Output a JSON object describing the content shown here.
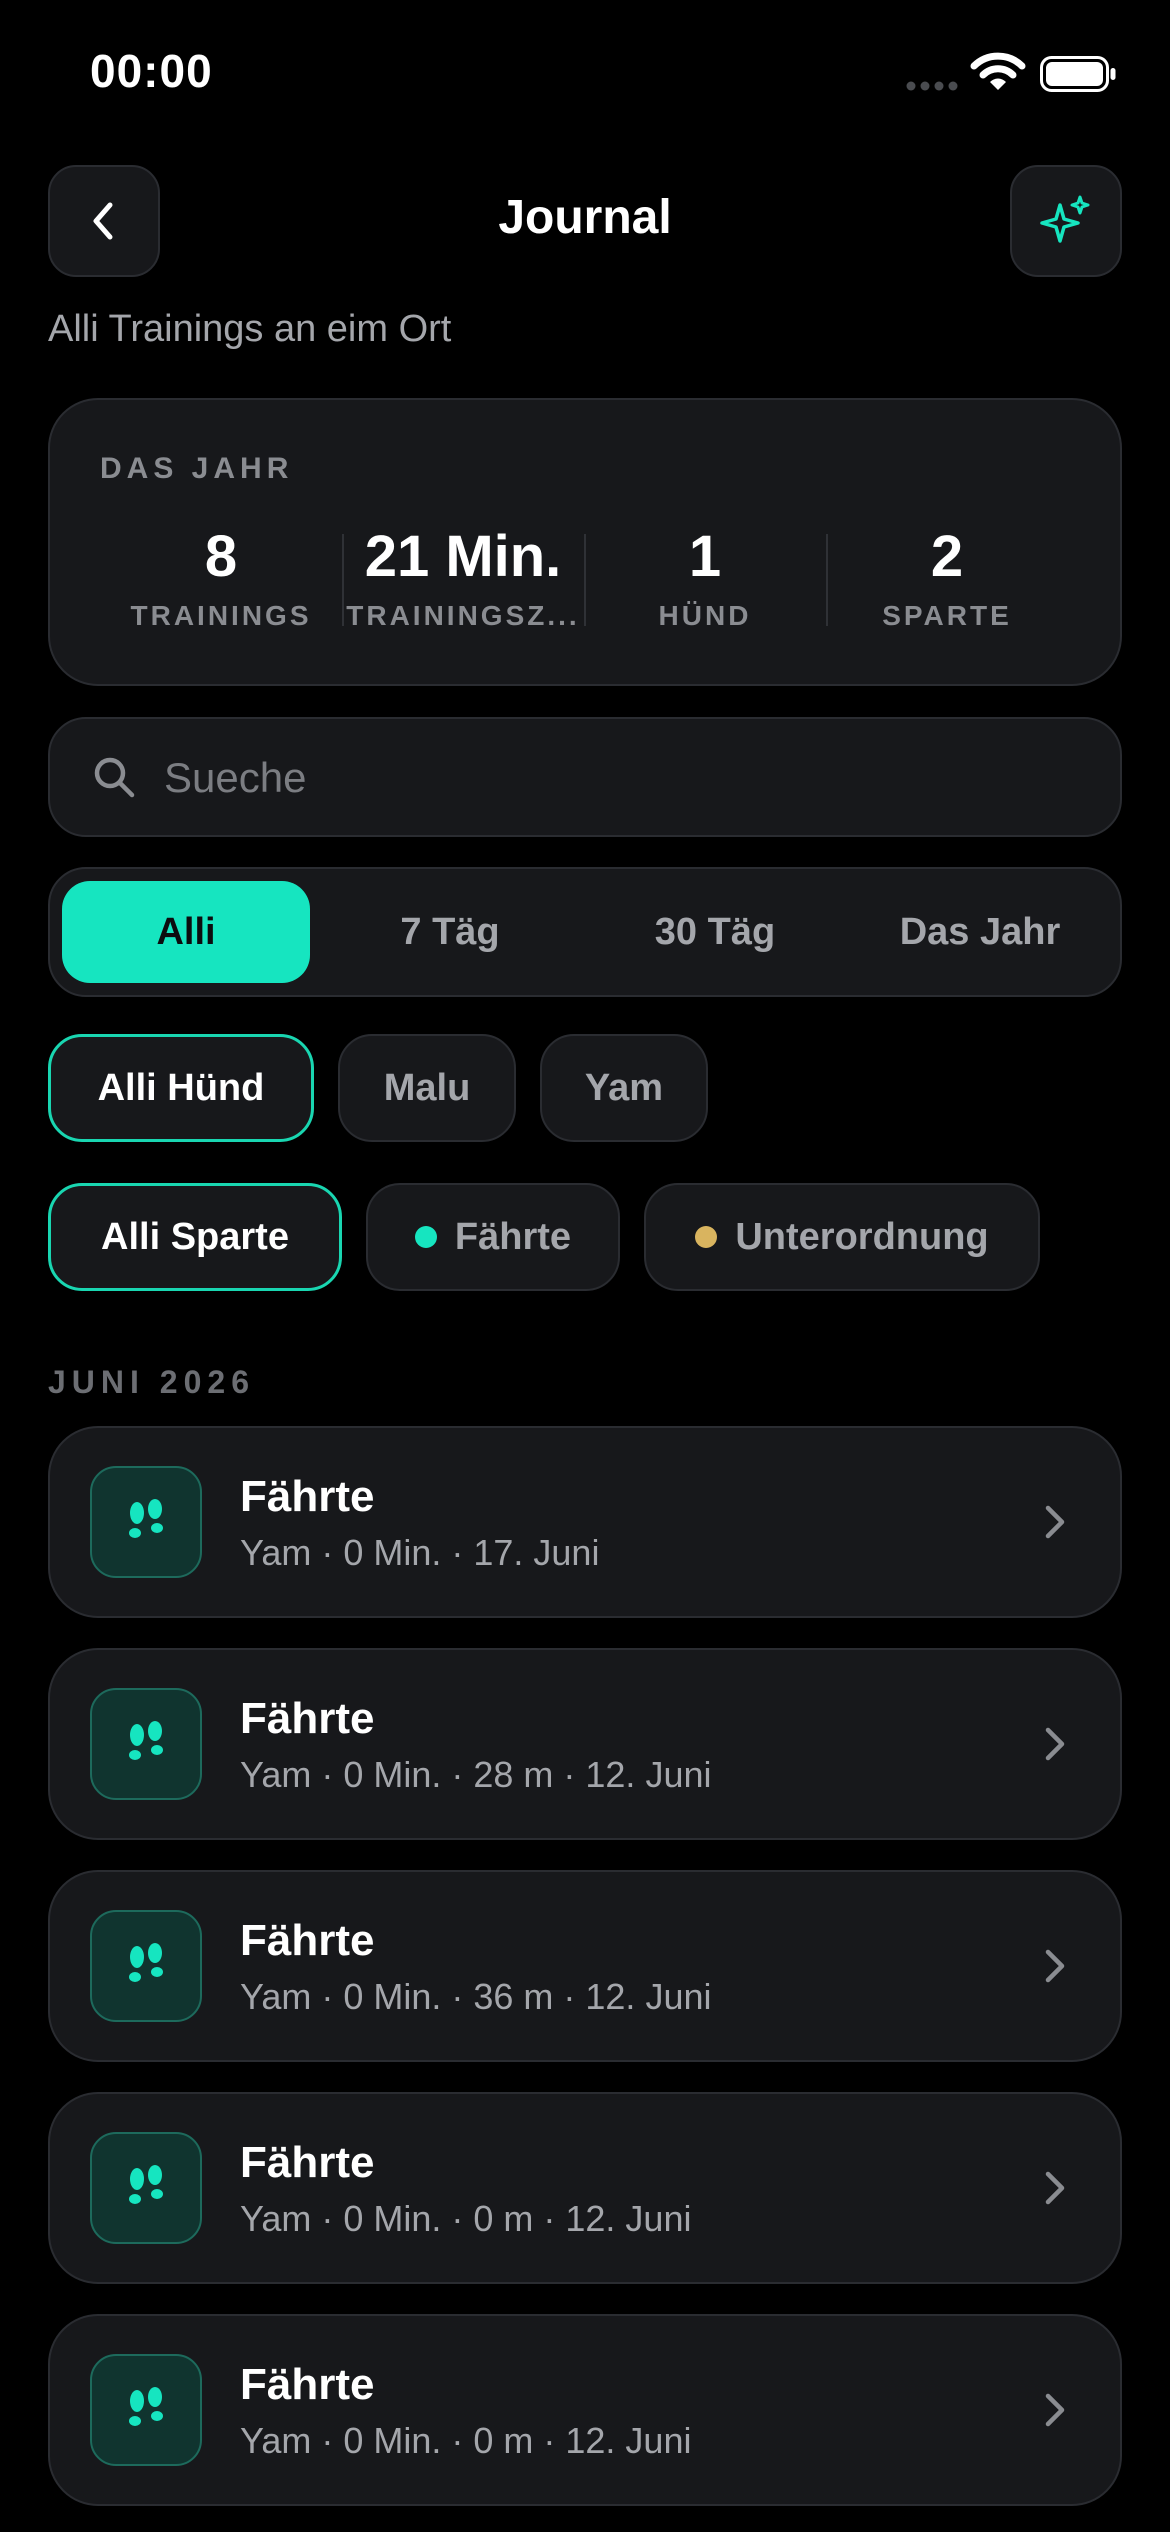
{
  "status_bar": {
    "time": "00:00"
  },
  "header": {
    "title": "Journal",
    "subtitle": "Alli Trainings an eim Ort"
  },
  "stats": {
    "heading": "DAS JAHR",
    "items": [
      {
        "value": "8",
        "label": "TRAININGS"
      },
      {
        "value": "21 Min.",
        "label": "TRAININGSZ..."
      },
      {
        "value": "1",
        "label": "HÜND"
      },
      {
        "value": "2",
        "label": "SPARTE"
      }
    ]
  },
  "search": {
    "placeholder": "Sueche",
    "value": ""
  },
  "time_filter": {
    "options": [
      "Alli",
      "7 Täg",
      "30 Täg",
      "Das Jahr"
    ],
    "selected": "Alli"
  },
  "dog_filter": {
    "options": [
      "Alli Hünd",
      "Malu",
      "Yam"
    ],
    "selected": "Alli Hünd"
  },
  "sport_filter": {
    "options": [
      {
        "label": "Alli Sparte"
      },
      {
        "label": "Fährte",
        "color": "#16e5c0"
      },
      {
        "label": "Unterordnung",
        "color": "#d9b45f"
      }
    ],
    "selected": "Alli Sparte"
  },
  "colors": {
    "accent": "#16e5c0",
    "card": "#17181b",
    "border": "#2a2c31",
    "muted": "#a4a6ab"
  },
  "section": {
    "label": "JUNI 2026"
  },
  "entries": [
    {
      "icon": "footprints-icon",
      "title": "Fährte",
      "meta": "Yam · 0 Min. · 17. Juni"
    },
    {
      "icon": "footprints-icon",
      "title": "Fährte",
      "meta": "Yam · 0 Min. · 28 m · 12. Juni"
    },
    {
      "icon": "footprints-icon",
      "title": "Fährte",
      "meta": "Yam · 0 Min. · 36 m · 12. Juni"
    },
    {
      "icon": "footprints-icon",
      "title": "Fährte",
      "meta": "Yam · 0 Min. · 0 m · 12. Juni"
    },
    {
      "icon": "footprints-icon",
      "title": "Fährte",
      "meta": "Yam · 0 Min. · 0 m · 12. Juni"
    }
  ]
}
